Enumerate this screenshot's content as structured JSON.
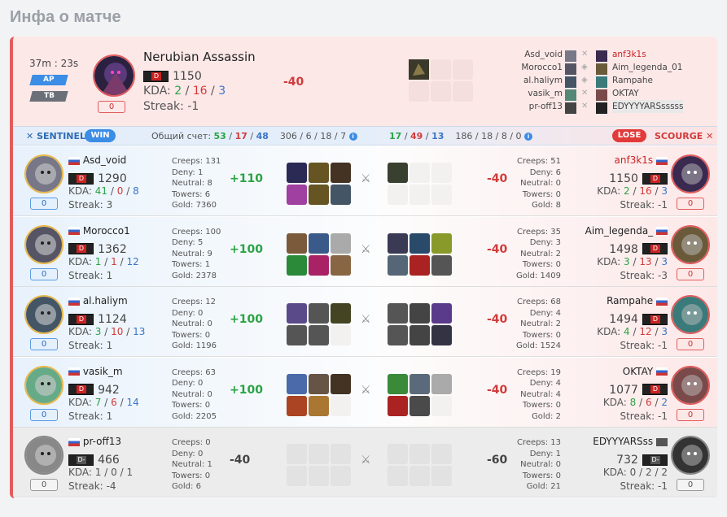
{
  "page_title": "Инфа о матче",
  "match": {
    "duration": "37m : 23s",
    "mode1": "AP",
    "mode2": "TB",
    "mode_count": "0",
    "hero_name": "Nerubian Assassin",
    "rating": "1150",
    "kda_label": "KDA:",
    "kda_k": "2",
    "kda_d": "16",
    "kda_a": "3",
    "streak": "Streak: -1",
    "delta": "-40"
  },
  "roster": {
    "sentinel": [
      "Asd_void",
      "Morocco1",
      "al.haliym",
      "vasik_m",
      "pr-off13"
    ],
    "scourge": [
      "anf3k1s",
      "Aim_legenda_01",
      "Rampahe",
      "OKTAY",
      "EDYYYYARSsssss"
    ]
  },
  "bar": {
    "sentinel_label": "SENTINEL",
    "win_label": "WIN",
    "score_label": "Общий счет:",
    "s_k": "53",
    "s_d": "17",
    "s_a": "48",
    "s_creeps": "306",
    "s_deny": "6",
    "s_x": "18",
    "s_y": "7",
    "c_k": "17",
    "c_d": "49",
    "c_a": "13",
    "c_creeps": "186",
    "c_deny": "18",
    "c_x": "8",
    "c_y": "0",
    "lose_label": "LOSE",
    "scourge_label": "SCOURGE",
    "sep": "/",
    "info": "i"
  },
  "labels": {
    "creeps": "Creeps:",
    "deny": "Deny:",
    "neutral": "Neutral:",
    "towers": "Towers:",
    "gold": "Gold:",
    "kda": "KDA:",
    "streak": "Streak:",
    "sep": "/",
    "d_badge": "D",
    "d_badge_grey": "D-"
  },
  "rows": [
    {
      "left": {
        "name": "Asd_void",
        "rating": "1290",
        "k": "41",
        "d": "0",
        "a": "8",
        "streak": "3",
        "box": "0",
        "creeps": "131",
        "deny": "1",
        "neutral": "8",
        "towers": "6",
        "gold": "7360",
        "delta": "+110"
      },
      "right": {
        "name": "anf3k1s",
        "rating": "1150",
        "k": "2",
        "d": "16",
        "a": "3",
        "streak": "-1",
        "box": "0",
        "creeps": "51",
        "deny": "6",
        "neutral": "0",
        "towers": "0",
        "gold": "8",
        "delta": "-40"
      }
    },
    {
      "left": {
        "name": "Morocco1",
        "rating": "1362",
        "k": "1",
        "d": "1",
        "a": "12",
        "streak": "1",
        "box": "0",
        "creeps": "100",
        "deny": "5",
        "neutral": "9",
        "towers": "1",
        "gold": "2378",
        "delta": "+100"
      },
      "right": {
        "name": "Aim_legenda_",
        "rating": "1498",
        "k": "3",
        "d": "13",
        "a": "3",
        "streak": "-3",
        "box": "0",
        "creeps": "35",
        "deny": "3",
        "neutral": "2",
        "towers": "0",
        "gold": "1409",
        "delta": "-40"
      }
    },
    {
      "left": {
        "name": "al.haliym",
        "rating": "1124",
        "k": "3",
        "d": "10",
        "a": "13",
        "streak": "1",
        "box": "0",
        "creeps": "12",
        "deny": "0",
        "neutral": "0",
        "towers": "0",
        "gold": "1196",
        "delta": "+100"
      },
      "right": {
        "name": "Rampahe",
        "rating": "1494",
        "k": "4",
        "d": "12",
        "a": "3",
        "streak": "-1",
        "box": "0",
        "creeps": "68",
        "deny": "4",
        "neutral": "2",
        "towers": "0",
        "gold": "1524",
        "delta": "-40"
      }
    },
    {
      "left": {
        "name": "vasik_m",
        "rating": "942",
        "k": "7",
        "d": "6",
        "a": "14",
        "streak": "1",
        "box": "0",
        "creeps": "63",
        "deny": "0",
        "neutral": "0",
        "towers": "0",
        "gold": "2205",
        "delta": "+100"
      },
      "right": {
        "name": "OKTAY",
        "rating": "1077",
        "k": "8",
        "d": "6",
        "a": "2",
        "streak": "-1",
        "box": "0",
        "creeps": "19",
        "deny": "4",
        "neutral": "4",
        "towers": "0",
        "gold": "2",
        "delta": "-40"
      }
    },
    {
      "left": {
        "name": "pr-off13",
        "rating": "466",
        "k": "1",
        "d": "0",
        "a": "1",
        "streak": "-4",
        "box": "0",
        "creeps": "0",
        "deny": "0",
        "neutral": "1",
        "towers": "0",
        "gold": "6",
        "delta": "-40"
      },
      "right": {
        "name": "EDYYYARSss",
        "rating": "732",
        "k": "0",
        "d": "2",
        "a": "2",
        "streak": "-1",
        "box": "0",
        "creeps": "13",
        "deny": "1",
        "neutral": "0",
        "towers": "0",
        "gold": "21",
        "delta": "-60"
      }
    }
  ],
  "colors": {
    "sentinel": "#3b8de6",
    "scourge": "#e23a3a",
    "positive": "#2aa344",
    "negative": "#d23b3b",
    "assist": "#3a74c5"
  }
}
